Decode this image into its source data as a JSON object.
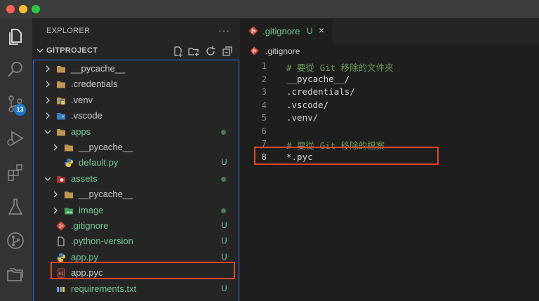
{
  "explorer": {
    "header": "EXPLORER",
    "more_label": "···",
    "project_name": "GITPROJECT"
  },
  "activity": {
    "scm_badge": "13"
  },
  "tree": [
    {
      "name": "__pycache__",
      "kind": "folder",
      "expanded": false,
      "level": 0,
      "status": ""
    },
    {
      "name": ".credentials",
      "kind": "folder",
      "expanded": false,
      "level": 0,
      "status": ""
    },
    {
      "name": ".venv",
      "kind": "folder-venv",
      "expanded": false,
      "level": 0,
      "status": ""
    },
    {
      "name": ".vscode",
      "kind": "folder-vscode",
      "expanded": false,
      "level": 0,
      "status": ""
    },
    {
      "name": "apps",
      "kind": "folder",
      "expanded": true,
      "level": 0,
      "status": "dot"
    },
    {
      "name": "__pycache__",
      "kind": "folder",
      "expanded": false,
      "level": 1,
      "status": ""
    },
    {
      "name": "default.py",
      "kind": "python",
      "level": 1,
      "status": "U"
    },
    {
      "name": "assets",
      "kind": "folder-assets",
      "expanded": true,
      "level": 0,
      "status": "dot"
    },
    {
      "name": "__pycache__",
      "kind": "folder",
      "expanded": false,
      "level": 1,
      "status": ""
    },
    {
      "name": "image",
      "kind": "folder-image",
      "expanded": false,
      "level": 1,
      "status": "dot"
    },
    {
      "name": ".gitignore",
      "kind": "git",
      "level": 0,
      "status": "U"
    },
    {
      "name": ".python-version",
      "kind": "file",
      "level": 0,
      "status": "U"
    },
    {
      "name": "app.py",
      "kind": "python",
      "level": 0,
      "status": "U"
    },
    {
      "name": "app.pyc",
      "kind": "binary",
      "level": 0,
      "status": ""
    },
    {
      "name": "requirements.txt",
      "kind": "text",
      "level": 0,
      "status": "U"
    }
  ],
  "editor": {
    "tab_label": ".gitignore",
    "tab_status": "U",
    "tab_close": "×",
    "breadcrumb": ".gitignore",
    "current_line": 8,
    "lines": [
      {
        "n": "1",
        "text": "# 要從 Git 移除的文件夾",
        "comment": true
      },
      {
        "n": "2",
        "text": "__pycache__/",
        "comment": false
      },
      {
        "n": "3",
        "text": ".credentials/",
        "comment": false
      },
      {
        "n": "4",
        "text": ".vscode/",
        "comment": false
      },
      {
        "n": "5",
        "text": ".venv/",
        "comment": false
      },
      {
        "n": "6",
        "text": "",
        "comment": false
      },
      {
        "n": "7",
        "text": "# 要從 Git 移除的檔案",
        "comment": true
      },
      {
        "n": "8",
        "text": "*.pyc",
        "comment": false
      }
    ]
  },
  "colors": {
    "accent_green": "#73c991",
    "highlight_red": "#e8442a",
    "folder": "#dcb67a",
    "git_red": "#e44d3a",
    "badge_blue": "#1a7ad0"
  }
}
